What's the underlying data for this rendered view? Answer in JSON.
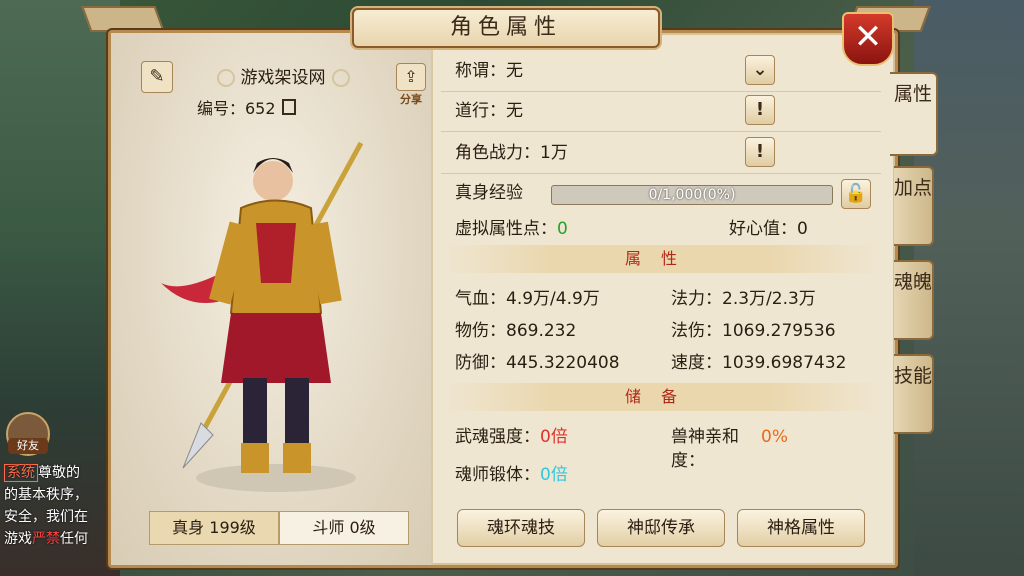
{
  "panel": {
    "title": "角色属性",
    "close_glyph": "✕"
  },
  "profile": {
    "name": "游戏架设网",
    "id_label": "编号：652",
    "share_label": "分享",
    "tabs": [
      {
        "label": "真身 199级",
        "active": true
      },
      {
        "label": "斗师 0级",
        "active": false
      }
    ]
  },
  "info": {
    "title_row": "称谓：无",
    "dao_row": "道行：无",
    "power_row": "角色战力：1万",
    "exp_label": "真身经验",
    "exp_progress_text": "0/1,000(0%)",
    "exp_progress": 0,
    "virtual_points_label": "虚拟属性点：",
    "virtual_points_value": "0",
    "kindness": "好心值：0"
  },
  "attributes": {
    "section_title": "属性",
    "items": [
      {
        "label": "气血：4.9万/4.9万"
      },
      {
        "label": "法力：2.3万/2.3万"
      },
      {
        "label": "物伤：869.232"
      },
      {
        "label": "法伤：1069.279536"
      },
      {
        "label": "防御：445.3220408"
      },
      {
        "label": "速度：1039.6987432"
      }
    ]
  },
  "reserve": {
    "section_title": "储备",
    "wuhun_label": "武魂强度：",
    "wuhun_value": "0倍",
    "beast_label_1": "兽神亲和",
    "beast_label_2": "度：",
    "beast_value": "0%",
    "soul_label": "魂师锻体：",
    "soul_value": "0倍"
  },
  "buttons": [
    "魂环魂技",
    "神邸传承",
    "神格属性"
  ],
  "side_tabs": [
    {
      "label": "属性",
      "active": true
    },
    {
      "label": "加点",
      "active": false
    },
    {
      "label": "魂魄",
      "active": false
    },
    {
      "label": "技能",
      "active": false
    }
  ],
  "chat": {
    "tag": "系统",
    "line1": "尊敬的",
    "line2": "的基本秩序，",
    "line3": "安全，我们在",
    "line4a": "游戏",
    "line4b": "严禁",
    "line4c": "任何"
  },
  "friend_label": "好友",
  "colors": {
    "accent_red": "#b02a1a",
    "value_green": "#2aa02a",
    "value_red": "#e0302a",
    "value_cyan": "#2ec8e0",
    "value_orange": "#e86a1a"
  }
}
